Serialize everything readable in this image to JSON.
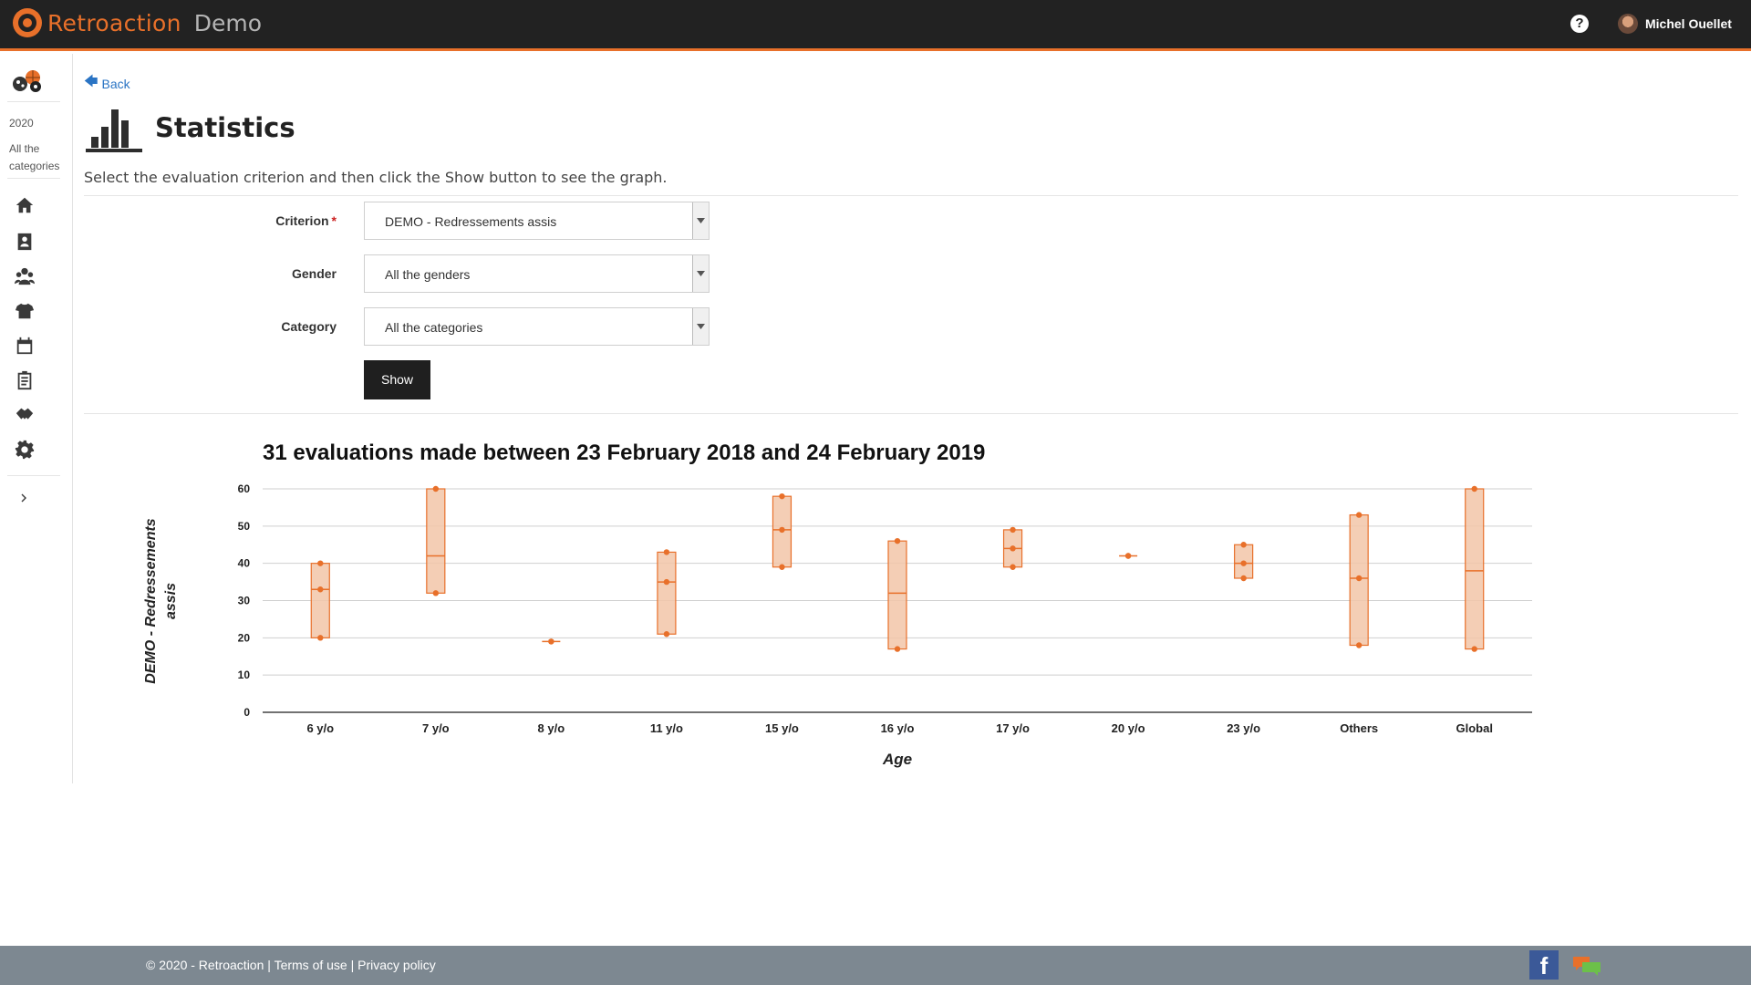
{
  "header": {
    "brand": "Retroaction",
    "env": "Demo",
    "user_name": "Michel Ouellet"
  },
  "sidebar": {
    "year": "2020",
    "category": "All the categories",
    "items": [
      {
        "icon": "home-icon"
      },
      {
        "icon": "athletes-icon"
      },
      {
        "icon": "groups-icon"
      },
      {
        "icon": "teams-icon"
      },
      {
        "icon": "calendar-icon"
      },
      {
        "icon": "evaluations-icon"
      },
      {
        "icon": "partners-icon"
      },
      {
        "icon": "settings-icon"
      }
    ]
  },
  "main": {
    "back_label": "Back",
    "title": "Statistics",
    "instructions": "Select the evaluation criterion and then click the Show button to see the graph.",
    "form": {
      "criterion_label": "Criterion",
      "criterion_required": "*",
      "criterion_value": "DEMO - Redressements assis",
      "gender_label": "Gender",
      "gender_value": "All the genders",
      "category_label": "Category",
      "category_value": "All the categories",
      "show_label": "Show"
    }
  },
  "chart_data": {
    "type": "box",
    "title": "31 evaluations made between 23 February 2018 and 24 February 2019",
    "xlabel": "Age",
    "ylabel": "DEMO - Redressements assis",
    "ylim": [
      0,
      60
    ],
    "yticks": [
      0,
      10,
      20,
      30,
      40,
      50,
      60
    ],
    "grid": true,
    "color": "#e8702a",
    "fill": "#f2c5a8",
    "categories": [
      "6 y/o",
      "7 y/o",
      "8 y/o",
      "11 y/o",
      "15 y/o",
      "16 y/o",
      "17 y/o",
      "20 y/o",
      "23 y/o",
      "Others",
      "Global"
    ],
    "max": [
      40,
      60,
      19,
      43,
      58,
      46,
      49,
      42,
      45,
      53,
      60
    ],
    "median": [
      33,
      42,
      19,
      35,
      49,
      32,
      44,
      42,
      40,
      36,
      38
    ],
    "min": [
      20,
      32,
      19,
      21,
      39,
      17,
      39,
      42,
      36,
      18,
      17
    ],
    "median_marker": [
      true,
      false,
      false,
      true,
      true,
      false,
      true,
      false,
      true,
      true,
      false
    ]
  },
  "footer": {
    "copyright": "© 2020 - Retroaction",
    "sep1": " | ",
    "terms": "Terms of use",
    "sep2": " | ",
    "privacy": "Privacy policy"
  }
}
